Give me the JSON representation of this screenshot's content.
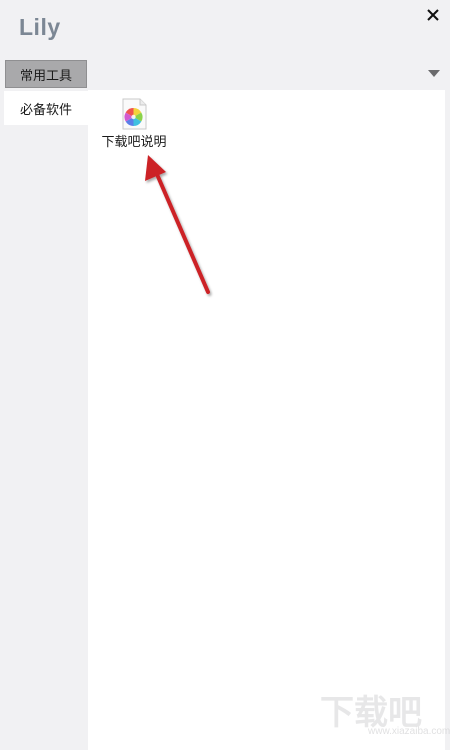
{
  "app": {
    "title": "Lily"
  },
  "window": {
    "close_icon": "close-icon"
  },
  "tabs": [
    {
      "label": "常用工具",
      "active": true
    }
  ],
  "tabbar": {
    "dropdown_icon": "chevron-down-icon"
  },
  "sidebar": {
    "items": [
      {
        "label": "必备软件",
        "selected": true
      }
    ]
  },
  "content": {
    "files": [
      {
        "label": "下载吧说明",
        "icon": "colorful-pinwheel-file-icon"
      }
    ]
  },
  "annotation": {
    "color": "#cc2026",
    "icon": "red-arrow-annotation"
  },
  "watermark": {
    "text": "下载吧",
    "subtext": "www.xiazaiba.com"
  }
}
